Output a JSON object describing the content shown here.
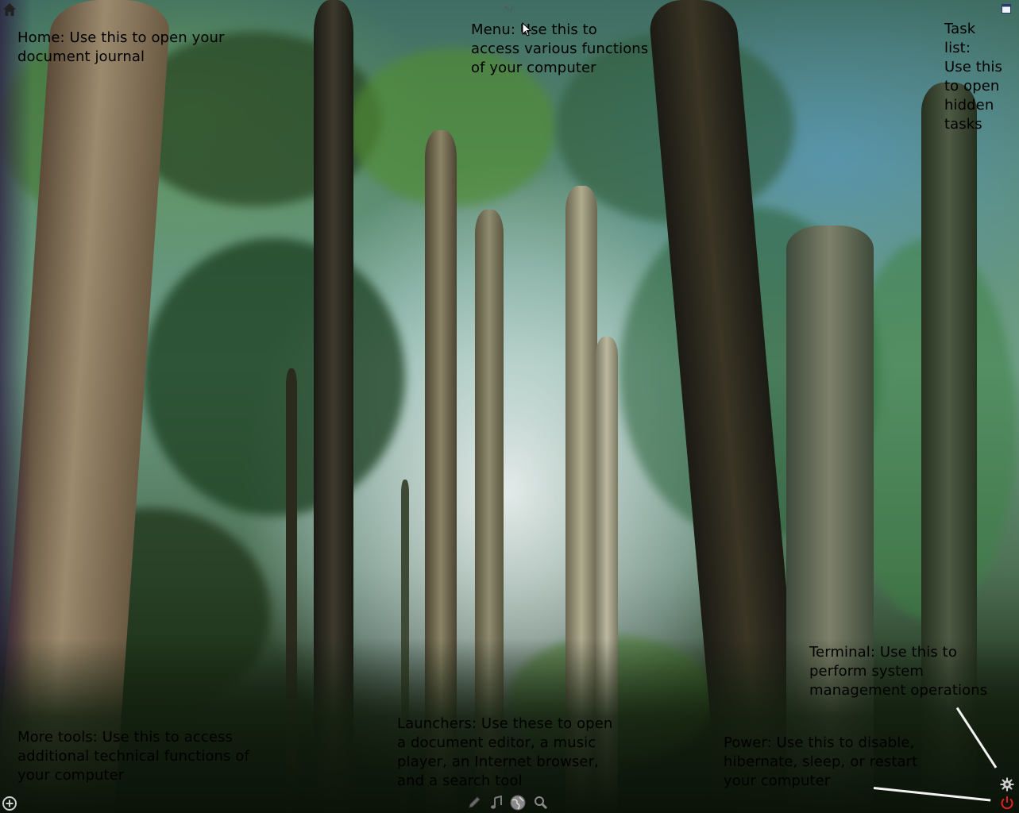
{
  "annotations": {
    "home": "Home: Use this to open your\ndocument journal",
    "menu": "Menu:    Use this to\naccess various functions\nof your computer",
    "task_list": "Task\nlist:\nUse this\nto open\nhidden\ntasks",
    "terminal": "Terminal: Use this to\nperform system\nmanagement operations",
    "more_tools": "More tools: Use this to access\nadditional technical functions of\nyour computer",
    "launchers": "Launchers: Use these to open\na document editor, a music\nplayer, an Internet browser,\nand a search tool",
    "power": "Power: Use this to disable,\nhibernate, sleep, or restart\nyour computer"
  },
  "top_bar": {
    "center_glyph": "↖/",
    "home_icon": "home-icon",
    "task_list_icon": "window-icon"
  },
  "bottom_bar": {
    "more_tools_icon": "plus-circle-icon",
    "launchers": [
      "pen-icon",
      "music-note-icon",
      "globe-icon",
      "search-icon"
    ],
    "terminal_icon": "gear-icon",
    "power_icon": "power-icon"
  },
  "colors": {
    "annotation_text": "#000000",
    "pointer_line": "#f2f2f2",
    "power_icon": "#e02020",
    "gear_icon": "#cfcfcf"
  }
}
